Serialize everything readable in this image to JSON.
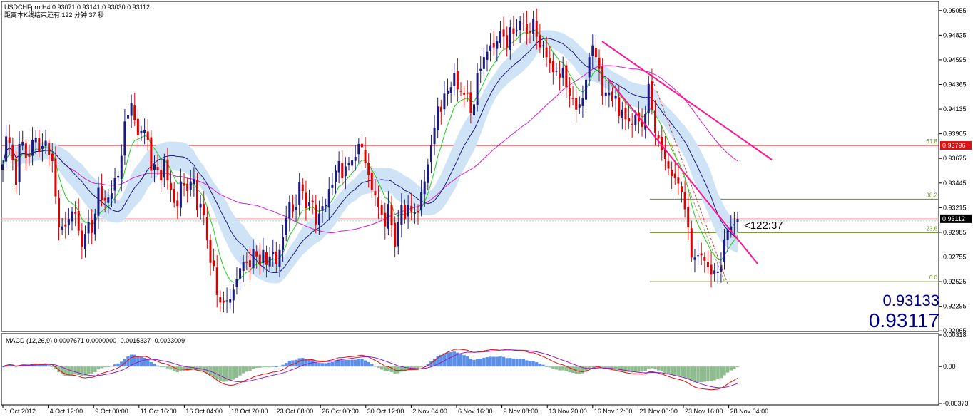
{
  "header": {
    "line1": "USDCHFpro,H4  0.93071 0.93141 0.93030 0.93112",
    "line2": "距离本K线结束还有:122 分钟 37 秒"
  },
  "colors": {
    "bull": "#1a1a80",
    "bear": "#e00000",
    "band": "#cfe3f7",
    "ma_fast": "#22cc22",
    "ma_mid": "#1a1a80",
    "ma_slow": "#d020d0",
    "trend": "#ff1493",
    "fib": "#6b8e23",
    "hline": "#e01010",
    "macd_hist_pos": "#5b8fe8",
    "macd_hist_neg": "#8fbc8f",
    "macd_line": "#e01010",
    "signal_line": "#9020c0",
    "big_price": "#00008b"
  },
  "chart_data": [
    {
      "type": "candlestick",
      "symbol": "USDCHFpro",
      "timeframe": "H4",
      "ohlc_last": {
        "open": 0.93071,
        "high": 0.93141,
        "low": 0.9303,
        "close": 0.93112
      },
      "ylim": [
        0.9206,
        0.9514
      ],
      "y_ticks": [
        "0.95055",
        "0.94825",
        "0.94595",
        "0.94365",
        "0.94135",
        "0.93905",
        "0.93675",
        "0.93445",
        "0.93215",
        "0.92985",
        "0.92755",
        "0.92525",
        "0.92295",
        "0.92065"
      ],
      "x_ticks": [
        "1 Oct 2012",
        "4 Oct 12:00",
        "9 Oct 00:00",
        "11 Oct 16:00",
        "16 Oct 04:00",
        "18 Oct 20:00",
        "23 Oct 08:00",
        "26 Oct 00:00",
        "30 Oct 12:00",
        "2 Nov 04:00",
        "6 Nov 16:00",
        "9 Nov 08:00",
        "13 Nov 20:00",
        "16 Nov 12:00",
        "21 Nov 00:00",
        "23 Nov 16:00",
        "28 Nov 04:00"
      ],
      "closes": [
        0.9362,
        0.9388,
        0.9382,
        0.9366,
        0.9343,
        0.9381,
        0.9383,
        0.9368,
        0.9369,
        0.9385,
        0.9387,
        0.9374,
        0.9379,
        0.9384,
        0.9371,
        0.9365,
        0.9332,
        0.9303,
        0.9304,
        0.9304,
        0.9311,
        0.9318,
        0.9316,
        0.93,
        0.9285,
        0.9297,
        0.9308,
        0.9298,
        0.9316,
        0.934,
        0.9329,
        0.9328,
        0.9331,
        0.9335,
        0.9349,
        0.9351,
        0.937,
        0.9402,
        0.9408,
        0.9419,
        0.9403,
        0.9389,
        0.9393,
        0.9394,
        0.9385,
        0.9356,
        0.9362,
        0.9357,
        0.9347,
        0.9367,
        0.9347,
        0.9338,
        0.9326,
        0.9323,
        0.9346,
        0.9342,
        0.9337,
        0.9346,
        0.9348,
        0.9319,
        0.9325,
        0.9315,
        0.9291,
        0.927,
        0.9267,
        0.924,
        0.9233,
        0.9233,
        0.9235,
        0.9236,
        0.9245,
        0.9255,
        0.9265,
        0.9271,
        0.927,
        0.9266,
        0.9283,
        0.9276,
        0.9268,
        0.9282,
        0.9268,
        0.9276,
        0.928,
        0.9269,
        0.9282,
        0.9294,
        0.9312,
        0.9327,
        0.9318,
        0.9322,
        0.9345,
        0.9337,
        0.9321,
        0.9327,
        0.9327,
        0.9306,
        0.9316,
        0.9323,
        0.9324,
        0.9339,
        0.9343,
        0.9356,
        0.9365,
        0.9349,
        0.936,
        0.9363,
        0.9366,
        0.9369,
        0.9381,
        0.9378,
        0.9363,
        0.9352,
        0.9338,
        0.9333,
        0.9322,
        0.9315,
        0.9304,
        0.9325,
        0.9305,
        0.9285,
        0.9308,
        0.9324,
        0.9311,
        0.9324,
        0.9318,
        0.9317,
        0.9317,
        0.9336,
        0.9346,
        0.9362,
        0.938,
        0.9396,
        0.9416,
        0.9411,
        0.9428,
        0.9431,
        0.9434,
        0.9447,
        0.9432,
        0.943,
        0.9427,
        0.9428,
        0.941,
        0.9418,
        0.9447,
        0.9451,
        0.9462,
        0.9467,
        0.9473,
        0.9471,
        0.9477,
        0.9486,
        0.9481,
        0.9471,
        0.949,
        0.9484,
        0.9487,
        0.9496,
        0.9493,
        0.9484,
        0.9485,
        0.9498,
        0.9481,
        0.9471,
        0.9473,
        0.9462,
        0.9456,
        0.9448,
        0.9449,
        0.9443,
        0.9452,
        0.9434,
        0.9426,
        0.9423,
        0.9413,
        0.9418,
        0.9424,
        0.9441,
        0.9462,
        0.9473,
        0.9462,
        0.9451,
        0.9426,
        0.9429,
        0.9429,
        0.9421,
        0.9426,
        0.9407,
        0.9413,
        0.9404,
        0.9402,
        0.9399,
        0.9408,
        0.9402,
        0.9397,
        0.9409,
        0.9437,
        0.9413,
        0.9391,
        0.9386,
        0.9375,
        0.9367,
        0.9358,
        0.9351,
        0.9349,
        0.9344,
        0.9336,
        0.932,
        0.9303,
        0.9275,
        0.9275,
        0.9277,
        0.9277,
        0.9272,
        0.9266,
        0.9259,
        0.9263,
        0.9262,
        0.9268,
        0.9292,
        0.9301,
        0.9304,
        0.9306,
        0.9311
      ],
      "fibonacci": [
        {
          "label": "61.8",
          "price": 0.93796
        },
        {
          "label": "38.2",
          "price": 0.93295
        },
        {
          "label": "23.6",
          "price": 0.92982
        },
        {
          "label": "0.0",
          "price": 0.92525
        }
      ],
      "horizontal_lines": [
        {
          "price": 0.93796,
          "label": "0.93796"
        }
      ],
      "current_price": {
        "label": "0.93112",
        "price": 0.93112
      },
      "countdown_label": "<122:37",
      "quote": {
        "ask": "0.93133",
        "bid": "0.93117"
      }
    },
    {
      "type": "histogram+line",
      "title": "MACD (12,26,9) 0.0007671 0.0000000 -0.0015337 -0.0023009",
      "y_ticks": [
        "0.00318",
        "0.00",
        "-0.00373"
      ],
      "ylim": [
        -0.00373,
        0.00318
      ]
    }
  ]
}
